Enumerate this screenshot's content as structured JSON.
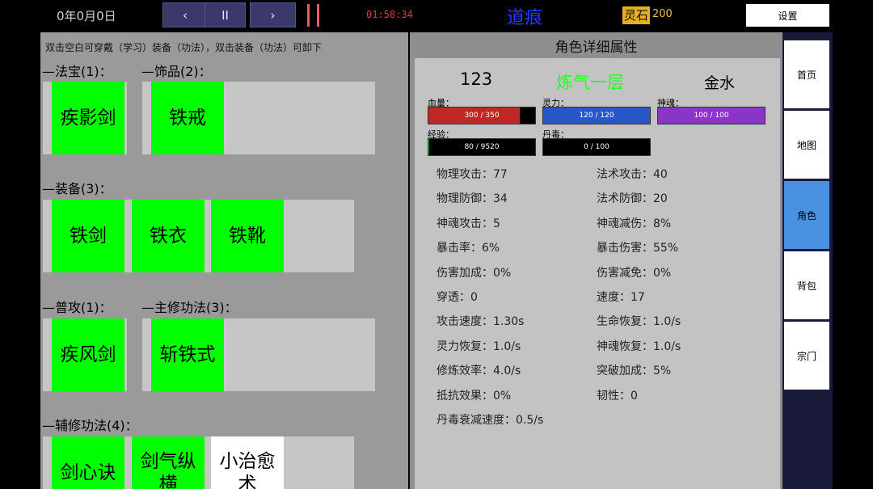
{
  "topbar": {
    "date": "0年0月0日",
    "prev_icon": "‹",
    "pause_icon": "II",
    "next_icon": "›",
    "clock": "01:58:34",
    "title": "道痕",
    "lingshi_label": "灵石",
    "lingshi_value": "200",
    "settings": "设置"
  },
  "equipment": {
    "hint": "双击空白可穿戴（学习）装备（功法），双击装备（功法）可卸下",
    "fabao_label": "—法宝(1)：",
    "shipin_label": "—饰品(2)：",
    "zhuangbei_label": "—装备(3)：",
    "pugong_label": "—普攻(1)：",
    "zhuxiu_label": "—主修功法(3)：",
    "fuxiu_label": "—辅修功法(4)：",
    "fabao": [
      "疾影剑"
    ],
    "shipin": [
      "铁戒"
    ],
    "zhuangbei": [
      "铁剑",
      "铁衣",
      "铁靴"
    ],
    "pugong": [
      "疾风剑"
    ],
    "zhuxiu": [
      "斩铁式"
    ],
    "fuxiu": [
      "剑心诀",
      "剑气纵横",
      "小治愈术"
    ]
  },
  "attributes": {
    "title": "角色详细属性",
    "name": "123",
    "realm": "炼气一层",
    "element": "金水",
    "bars": {
      "hp": {
        "label": "血量：",
        "text": "300 / 350",
        "fraction": 0.857,
        "color": "#c02828"
      },
      "mp": {
        "label": "灵力：",
        "text": "120 / 120",
        "fraction": 1.0,
        "color": "#2858c8"
      },
      "soul": {
        "label": "神魂：",
        "text": "100 / 100",
        "fraction": 1.0,
        "color": "#8a34c8"
      },
      "exp": {
        "label": "经验：",
        "text": "80 / 9520",
        "fraction": 0.008,
        "color": "#28a028"
      },
      "poison": {
        "label": "丹毒：",
        "text": "0 / 100",
        "fraction": 0.0,
        "color": "#28a028"
      }
    },
    "stats_left": [
      "物理攻击：77",
      "物理防御：34",
      "神魂攻击：5",
      "暴击率：6%",
      "伤害加成：0%",
      "穿透：0",
      "攻击速度：1.30s",
      "灵力恢复：1.0/s",
      "修炼效率：4.0/s",
      "抵抗效果：0%",
      "丹毒衰减速度：0.5/s"
    ],
    "stats_right": [
      "法术攻击：40",
      "法术防御：20",
      "神魂减伤：8%",
      "暴击伤害：55%",
      "伤害减免：0%",
      "速度：17",
      "生命恢复：1.0/s",
      "神魂恢复：1.0/s",
      "突破加成：5%",
      "韧性：0"
    ]
  },
  "nav": {
    "items": [
      "首页",
      "地图",
      "角色",
      "背包",
      "宗门"
    ],
    "active_index": 2
  }
}
